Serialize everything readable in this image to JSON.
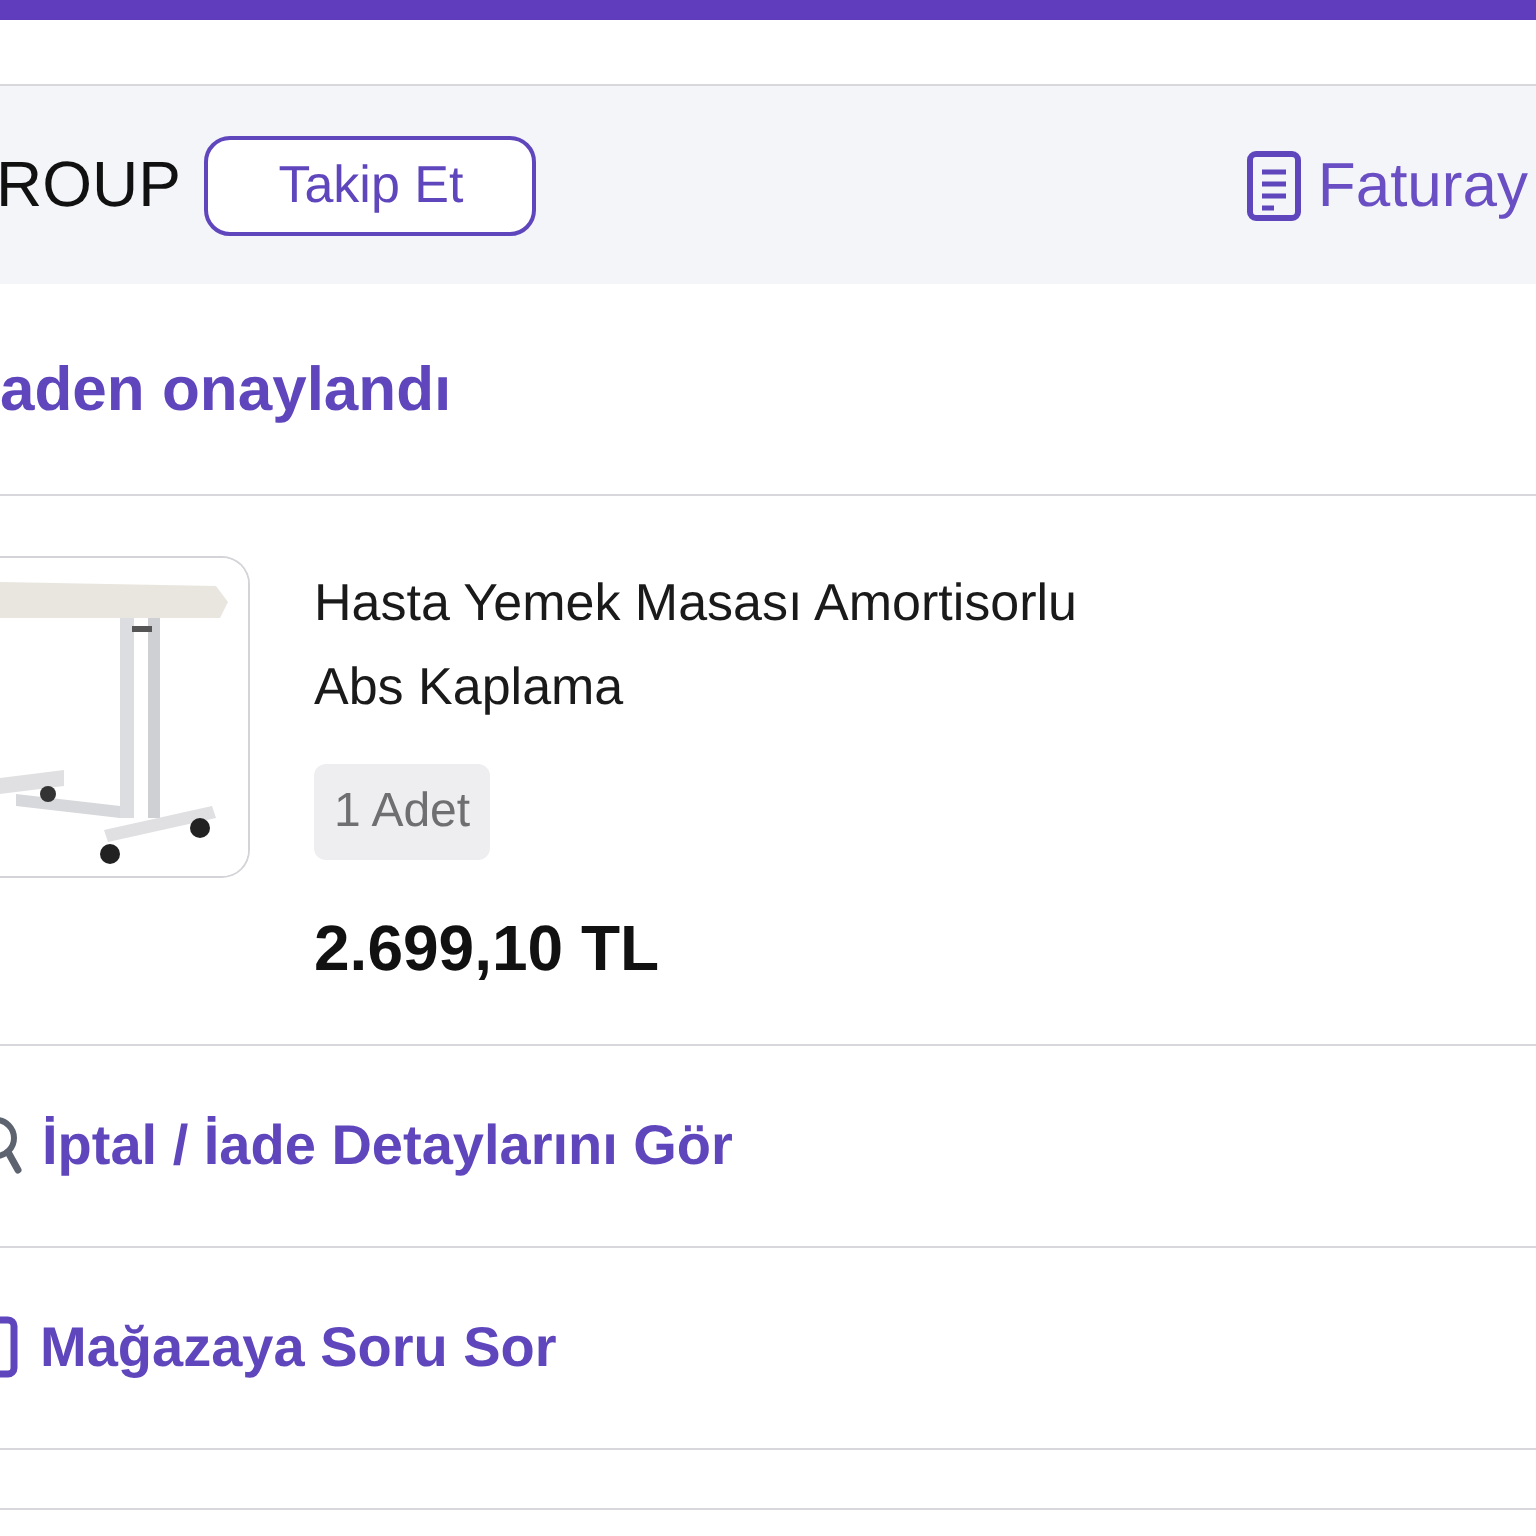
{
  "store": {
    "name": "ROUP",
    "follow_button": "Takip Et",
    "invoice_link": "Faturay"
  },
  "status": "aden onaylandı",
  "product": {
    "title_lines": [
      "Hasta Yemek Masası Amortisorlu",
      "Abs Kaplama"
    ],
    "quantity": "1 Adet",
    "price": "2.699,10 TL"
  },
  "actions": [
    {
      "kind": "search",
      "label": "İptal / İade Detaylarını Gör"
    },
    {
      "kind": "chat",
      "label": "Mağazaya Soru Sor"
    }
  ]
}
